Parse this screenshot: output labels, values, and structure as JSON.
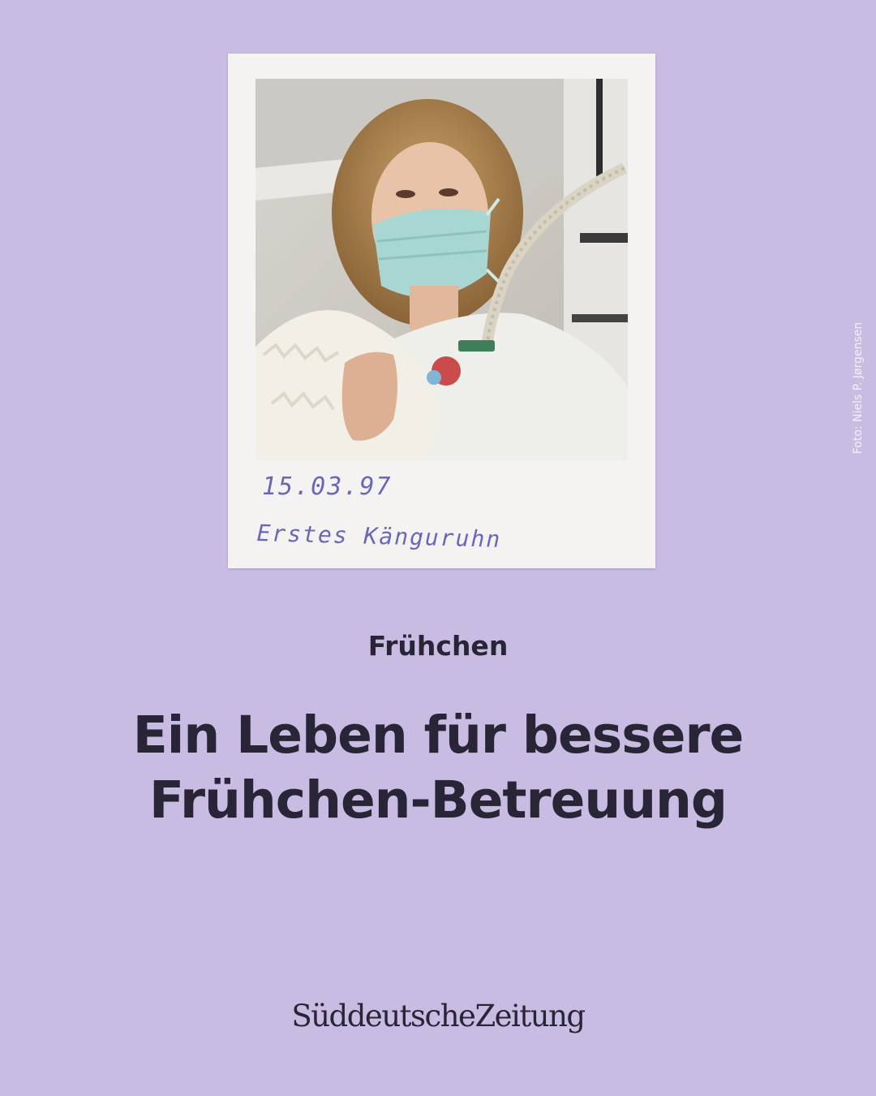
{
  "photo": {
    "handwritten_date": "15.03.97",
    "handwritten_caption": "Erstes Känguruhn",
    "credit": "Foto: Niels P. Jørgensen"
  },
  "kicker": "Frühchen",
  "headline": {
    "line1": "Ein Leben für bessere",
    "line2": "Frühchen-Betreuung"
  },
  "brand": {
    "logo_text": "SüddeutscheZeitung"
  },
  "colors": {
    "background": "#c9bce3",
    "text": "#272536",
    "handwriting": "#6a66b8"
  }
}
